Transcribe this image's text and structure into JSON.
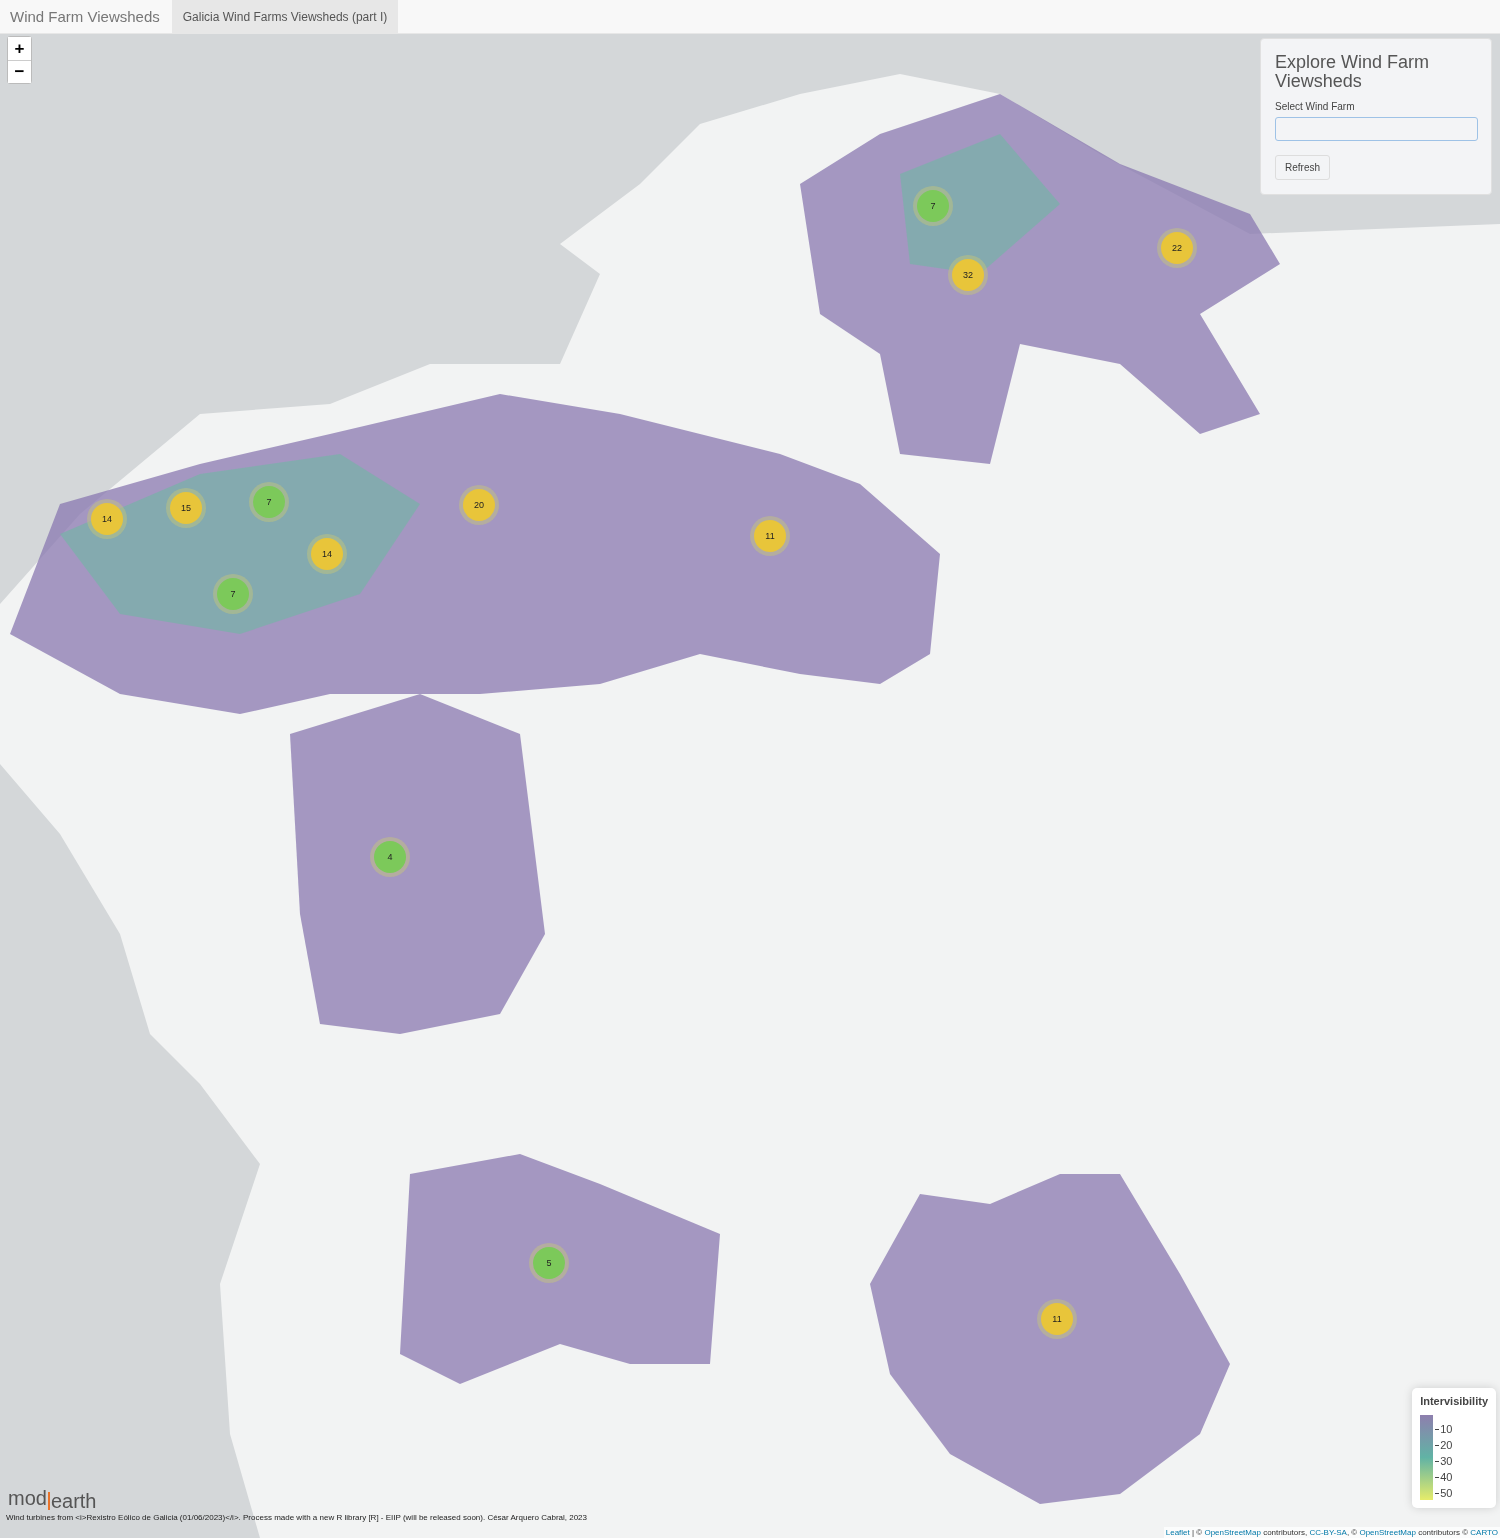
{
  "navbar": {
    "brand": "Wind Farm Viewsheds",
    "tabs": [
      {
        "label": "Galicia Wind Farms Viewsheds (part I)",
        "selected": true
      }
    ]
  },
  "zoom_controls": [
    "+",
    "−"
  ],
  "panel": {
    "title": "Explore Wind Farm Viewsheds",
    "field_label": "Select Wind Farm",
    "button": "Refresh"
  },
  "clusters": [
    {
      "count": "7",
      "color": "#7cc95a"
    },
    {
      "count": "32",
      "color": "#e8c53a"
    },
    {
      "count": "22",
      "color": "#e8c53a"
    },
    {
      "count": "14",
      "color": "#e8c53a"
    },
    {
      "count": "15",
      "color": "#e8c53a"
    },
    {
      "count": "7",
      "color": "#7cc95a"
    },
    {
      "count": "20",
      "color": "#e8c53a"
    },
    {
      "count": "14",
      "color": "#e8c53a"
    },
    {
      "count": "7",
      "color": "#7cc95a"
    },
    {
      "count": "11",
      "color": "#e8c53a"
    },
    {
      "count": "4",
      "color": "#7cc95a"
    },
    {
      "count": "5",
      "color": "#7cc95a"
    },
    {
      "count": "11",
      "color": "#e8c53a"
    }
  ],
  "legend": {
    "title": "Intervisibility",
    "ticks": [
      "10",
      "20",
      "30",
      "40",
      "50"
    ]
  },
  "logo": {
    "part_1": "mod",
    "part_2": "earth"
  },
  "credits": "Wind turbines from <i>Rexistro Eólico de Galicia (01/06/2023)</i>. Process made with a new R library [R] - EIIP (will be released soon). César Arquero Cabral, 2023",
  "attribution": [
    {
      "kind": "link",
      "text": "Leaflet"
    },
    {
      "kind": "text",
      "text": " | © "
    },
    {
      "kind": "link",
      "text": "OpenStreetMap"
    },
    {
      "kind": "text",
      "text": " contributors, "
    },
    {
      "kind": "link",
      "text": "CC-BY-SA"
    },
    {
      "kind": "text",
      "text": ", © "
    },
    {
      "kind": "link",
      "text": "OpenStreetMap"
    },
    {
      "kind": "text",
      "text": " contributors © "
    },
    {
      "kind": "link",
      "text": "CARTO"
    }
  ]
}
